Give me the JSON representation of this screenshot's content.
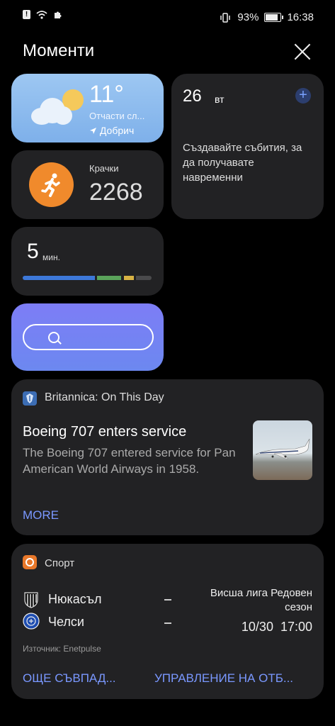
{
  "status_bar": {
    "battery": "93%",
    "battery_level": 0.93,
    "time": "16:38"
  },
  "header": {
    "title": "Моменти"
  },
  "weather": {
    "temperature": "11°",
    "description": "Отчасти сл...",
    "location": "Добрич"
  },
  "calendar": {
    "day": "26",
    "weekday": "вт",
    "add": "+",
    "message": "Създавайте събития, за да получавате навременни"
  },
  "steps": {
    "label": "Крачки",
    "count": "2268"
  },
  "screen_time": {
    "value": "5",
    "unit": "мин.",
    "segments": [
      {
        "color": "#3d78d8",
        "fraction": 0.56
      },
      {
        "color": "#5aa35a",
        "fraction": 0.19
      },
      {
        "color": "#d8b344",
        "fraction": 0.08
      },
      {
        "color": "#4a4a4c",
        "fraction": 0.12
      }
    ]
  },
  "britannica": {
    "source": "Britannica: On This Day",
    "title": "Boeing 707 enters service",
    "description": "The Boeing 707 entered service for Pan American World Airways in 1958.",
    "more": "MORE"
  },
  "sport": {
    "title": "Спорт",
    "home_team": "Нюкасъл",
    "away_team": "Челси",
    "home_score": "–",
    "away_score": "–",
    "league": "Висша лига Редовен сезон",
    "date_time": "10/30  17:00",
    "source": "Източник: Enetpulse",
    "link_matches": "ОЩЕ СЪВПАД...",
    "link_manage": "УПРАВЛЕНИЕ НА ОТБ..."
  },
  "colors": {
    "accent": "#7a98ff",
    "card": "#222224",
    "steps": "#f08a2c"
  }
}
